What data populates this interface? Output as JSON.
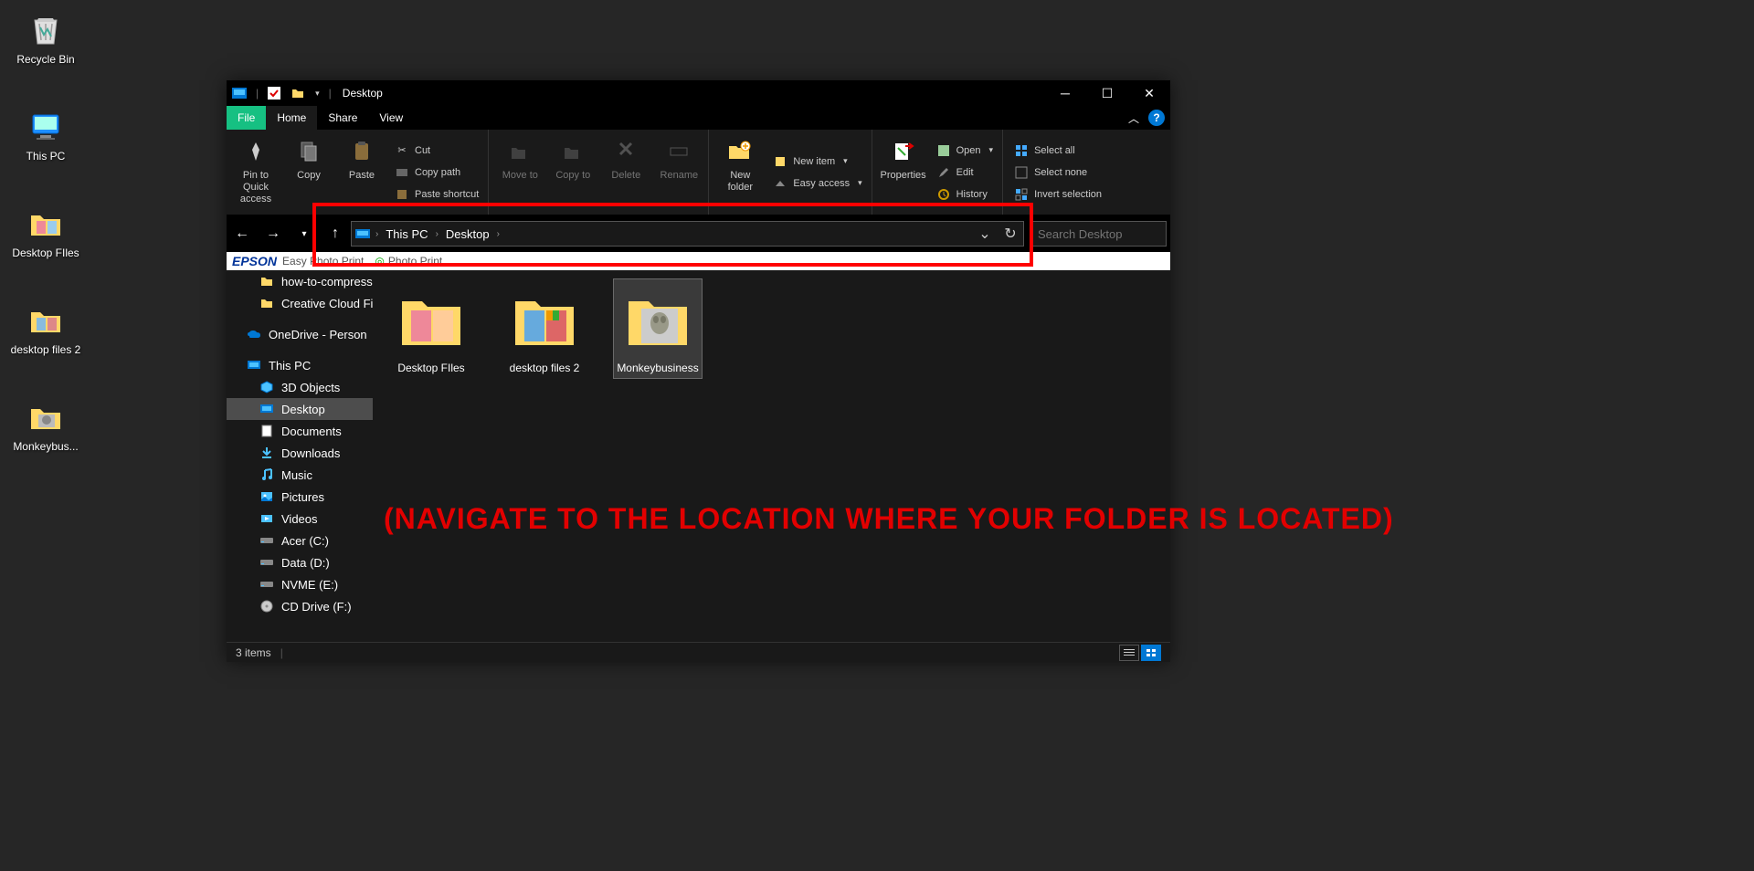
{
  "desktop": {
    "icons": [
      {
        "label": "Recycle Bin"
      },
      {
        "label": "This PC"
      },
      {
        "label": "Desktop FIles"
      },
      {
        "label": "desktop files 2"
      },
      {
        "label": "Monkeybus..."
      }
    ]
  },
  "explorer": {
    "title": "Desktop",
    "menu": {
      "file": "File",
      "home": "Home",
      "share": "Share",
      "view": "View"
    },
    "ribbon": {
      "pin": "Pin to Quick access",
      "copy": "Copy",
      "paste": "Paste",
      "cut": "Cut",
      "copypath": "Copy path",
      "pasteshortcut": "Paste shortcut",
      "moveto": "Move to",
      "copyto": "Copy to",
      "delete": "Delete",
      "rename": "Rename",
      "newfolder": "New folder",
      "newitem": "New item",
      "easyaccess": "Easy access",
      "properties": "Properties",
      "open": "Open",
      "edit": "Edit",
      "history": "History",
      "selectall": "Select all",
      "selectnone": "Select none",
      "invert": "Invert selection"
    },
    "breadcrumb": {
      "thispc": "This PC",
      "desktop": "Desktop"
    },
    "search_placeholder": "Search Desktop",
    "epson": {
      "brand": "EPSON",
      "text": "Easy Photo Print",
      "photo": "Photo Print"
    },
    "navpane": [
      {
        "label": "how-to-compress",
        "lvl": 1,
        "icon": "folder"
      },
      {
        "label": "Creative Cloud File",
        "lvl": 1,
        "icon": "cloud-folder"
      },
      {
        "label": "OneDrive - Person",
        "lvl": 0,
        "icon": "onedrive"
      },
      {
        "label": "This PC",
        "lvl": 0,
        "icon": "pc"
      },
      {
        "label": "3D Objects",
        "lvl": 1,
        "icon": "3d"
      },
      {
        "label": "Desktop",
        "lvl": 1,
        "icon": "desktop",
        "selected": true
      },
      {
        "label": "Documents",
        "lvl": 1,
        "icon": "doc"
      },
      {
        "label": "Downloads",
        "lvl": 1,
        "icon": "download"
      },
      {
        "label": "Music",
        "lvl": 1,
        "icon": "music"
      },
      {
        "label": "Pictures",
        "lvl": 1,
        "icon": "pictures"
      },
      {
        "label": "Videos",
        "lvl": 1,
        "icon": "video"
      },
      {
        "label": "Acer (C:)",
        "lvl": 1,
        "icon": "drive"
      },
      {
        "label": "Data (D:)",
        "lvl": 1,
        "icon": "drive"
      },
      {
        "label": "NVME (E:)",
        "lvl": 1,
        "icon": "drive"
      },
      {
        "label": "CD Drive (F:)",
        "lvl": 1,
        "icon": "cd"
      }
    ],
    "folders": [
      {
        "label": "Desktop FIles"
      },
      {
        "label": "desktop files 2"
      },
      {
        "label": "Monkeybusiness",
        "selected": true
      }
    ],
    "status": "3 items",
    "annotation": "(NAVIGATE TO THE LOCATION WHERE YOUR FOLDER IS LOCATED)"
  }
}
